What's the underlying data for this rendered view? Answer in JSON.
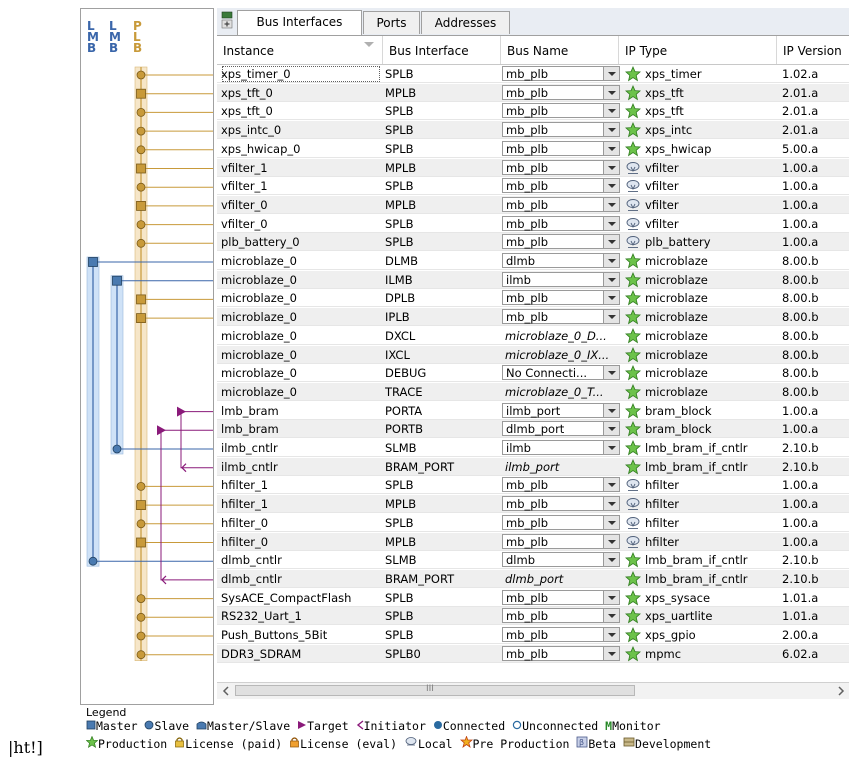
{
  "bus_header": {
    "letters": [
      "L",
      "M",
      "B",
      "L",
      "M",
      "B",
      "P",
      "L",
      "B"
    ]
  },
  "tabs": [
    {
      "label": "Bus Interfaces",
      "active": true
    },
    {
      "label": "Ports",
      "active": false
    },
    {
      "label": "Addresses",
      "active": false
    }
  ],
  "columns": [
    "Instance",
    "Bus Interface",
    "Bus Name",
    "IP Type",
    "IP Version"
  ],
  "rows": [
    {
      "instance": "xps_timer_0",
      "iface": "SPLB",
      "bus": "mb_plb",
      "bus_kind": "combo",
      "icon": "production",
      "ip": "xps_timer",
      "ver": "1.02.a"
    },
    {
      "instance": "xps_tft_0",
      "iface": "MPLB",
      "bus": "mb_plb",
      "bus_kind": "combo",
      "icon": "production",
      "ip": "xps_tft",
      "ver": "2.01.a"
    },
    {
      "instance": "xps_tft_0",
      "iface": "SPLB",
      "bus": "mb_plb",
      "bus_kind": "combo",
      "icon": "production",
      "ip": "xps_tft",
      "ver": "2.01.a"
    },
    {
      "instance": "xps_intc_0",
      "iface": "SPLB",
      "bus": "mb_plb",
      "bus_kind": "combo",
      "icon": "production",
      "ip": "xps_intc",
      "ver": "2.01.a"
    },
    {
      "instance": "xps_hwicap_0",
      "iface": "SPLB",
      "bus": "mb_plb",
      "bus_kind": "combo",
      "icon": "production",
      "ip": "xps_hwicap",
      "ver": "5.00.a"
    },
    {
      "instance": "vfilter_1",
      "iface": "MPLB",
      "bus": "mb_plb",
      "bus_kind": "combo",
      "icon": "local",
      "ip": "vfilter",
      "ver": "1.00.a"
    },
    {
      "instance": "vfilter_1",
      "iface": "SPLB",
      "bus": "mb_plb",
      "bus_kind": "combo",
      "icon": "local",
      "ip": "vfilter",
      "ver": "1.00.a"
    },
    {
      "instance": "vfilter_0",
      "iface": "MPLB",
      "bus": "mb_plb",
      "bus_kind": "combo",
      "icon": "local",
      "ip": "vfilter",
      "ver": "1.00.a"
    },
    {
      "instance": "vfilter_0",
      "iface": "SPLB",
      "bus": "mb_plb",
      "bus_kind": "combo",
      "icon": "local",
      "ip": "vfilter",
      "ver": "1.00.a"
    },
    {
      "instance": "plb_battery_0",
      "iface": "SPLB",
      "bus": "mb_plb",
      "bus_kind": "combo",
      "icon": "local",
      "ip": "plb_battery",
      "ver": "1.00.a"
    },
    {
      "instance": "microblaze_0",
      "iface": "DLMB",
      "bus": "dlmb",
      "bus_kind": "combo",
      "icon": "production",
      "ip": "microblaze",
      "ver": "8.00.b"
    },
    {
      "instance": "microblaze_0",
      "iface": "ILMB",
      "bus": "ilmb",
      "bus_kind": "combo",
      "icon": "production",
      "ip": "microblaze",
      "ver": "8.00.b"
    },
    {
      "instance": "microblaze_0",
      "iface": "DPLB",
      "bus": "mb_plb",
      "bus_kind": "combo",
      "icon": "production",
      "ip": "microblaze",
      "ver": "8.00.b"
    },
    {
      "instance": "microblaze_0",
      "iface": "IPLB",
      "bus": "mb_plb",
      "bus_kind": "combo",
      "icon": "production",
      "ip": "microblaze",
      "ver": "8.00.b"
    },
    {
      "instance": "microblaze_0",
      "iface": "DXCL",
      "bus": "microblaze_0_D...",
      "bus_kind": "italic",
      "icon": "production",
      "ip": "microblaze",
      "ver": "8.00.b"
    },
    {
      "instance": "microblaze_0",
      "iface": "IXCL",
      "bus": "microblaze_0_IX...",
      "bus_kind": "italic",
      "icon": "production",
      "ip": "microblaze",
      "ver": "8.00.b"
    },
    {
      "instance": "microblaze_0",
      "iface": "DEBUG",
      "bus": "No Connecti...",
      "bus_kind": "combo",
      "icon": "production",
      "ip": "microblaze",
      "ver": "8.00.b"
    },
    {
      "instance": "microblaze_0",
      "iface": "TRACE",
      "bus": "microblaze_0_T...",
      "bus_kind": "italic",
      "icon": "production",
      "ip": "microblaze",
      "ver": "8.00.b"
    },
    {
      "instance": "lmb_bram",
      "iface": "PORTA",
      "bus": "ilmb_port",
      "bus_kind": "combo",
      "icon": "production",
      "ip": "bram_block",
      "ver": "1.00.a"
    },
    {
      "instance": "lmb_bram",
      "iface": "PORTB",
      "bus": "dlmb_port",
      "bus_kind": "combo",
      "icon": "production",
      "ip": "bram_block",
      "ver": "1.00.a"
    },
    {
      "instance": "ilmb_cntlr",
      "iface": "SLMB",
      "bus": "ilmb",
      "bus_kind": "combo",
      "icon": "production",
      "ip": "lmb_bram_if_cntlr",
      "ver": "2.10.b"
    },
    {
      "instance": "ilmb_cntlr",
      "iface": "BRAM_PORT",
      "bus": "ilmb_port",
      "bus_kind": "italic",
      "icon": "production",
      "ip": "lmb_bram_if_cntlr",
      "ver": "2.10.b"
    },
    {
      "instance": "hfilter_1",
      "iface": "SPLB",
      "bus": "mb_plb",
      "bus_kind": "combo",
      "icon": "local",
      "ip": "hfilter",
      "ver": "1.00.a"
    },
    {
      "instance": "hfilter_1",
      "iface": "MPLB",
      "bus": "mb_plb",
      "bus_kind": "combo",
      "icon": "local",
      "ip": "hfilter",
      "ver": "1.00.a"
    },
    {
      "instance": "hfilter_0",
      "iface": "SPLB",
      "bus": "mb_plb",
      "bus_kind": "combo",
      "icon": "local",
      "ip": "hfilter",
      "ver": "1.00.a"
    },
    {
      "instance": "hfilter_0",
      "iface": "MPLB",
      "bus": "mb_plb",
      "bus_kind": "combo",
      "icon": "local",
      "ip": "hfilter",
      "ver": "1.00.a"
    },
    {
      "instance": "dlmb_cntlr",
      "iface": "SLMB",
      "bus": "dlmb",
      "bus_kind": "combo",
      "icon": "production",
      "ip": "lmb_bram_if_cntlr",
      "ver": "2.10.b"
    },
    {
      "instance": "dlmb_cntlr",
      "iface": "BRAM_PORT",
      "bus": "dlmb_port",
      "bus_kind": "italic",
      "icon": "production",
      "ip": "lmb_bram_if_cntlr",
      "ver": "2.10.b"
    },
    {
      "instance": "SysACE_CompactFlash",
      "iface": "SPLB",
      "bus": "mb_plb",
      "bus_kind": "combo",
      "icon": "production",
      "ip": "xps_sysace",
      "ver": "1.01.a"
    },
    {
      "instance": "RS232_Uart_1",
      "iface": "SPLB",
      "bus": "mb_plb",
      "bus_kind": "combo",
      "icon": "production",
      "ip": "xps_uartlite",
      "ver": "1.01.a"
    },
    {
      "instance": "Push_Buttons_5Bit",
      "iface": "SPLB",
      "bus": "mb_plb",
      "bus_kind": "combo",
      "icon": "production",
      "ip": "xps_gpio",
      "ver": "2.00.a"
    },
    {
      "instance": "DDR3_SDRAM",
      "iface": "SPLB0",
      "bus": "mb_plb",
      "bus_kind": "combo",
      "icon": "production",
      "ip": "mpmc",
      "ver": "6.02.a"
    }
  ],
  "legend": {
    "title": "Legend",
    "items1": [
      "Master",
      "Slave",
      "Master/Slave",
      "Target",
      "Initiator",
      "Connected",
      "Unconnected",
      "Monitor"
    ],
    "monitor_letter": "M",
    "items2": [
      "Production",
      "License (paid)",
      "License (eval)",
      "Local",
      "Pre Production",
      "Beta",
      "Development"
    ]
  },
  "scroll_grip": "III",
  "footer_text": "|ht!]",
  "colors": {
    "plb": "#c89a3a",
    "lmb": "#3a66aa",
    "bram": "#8a1a7a",
    "bus_fill": "#f6e6c8",
    "lmb_fill": "#cfe2f7"
  }
}
